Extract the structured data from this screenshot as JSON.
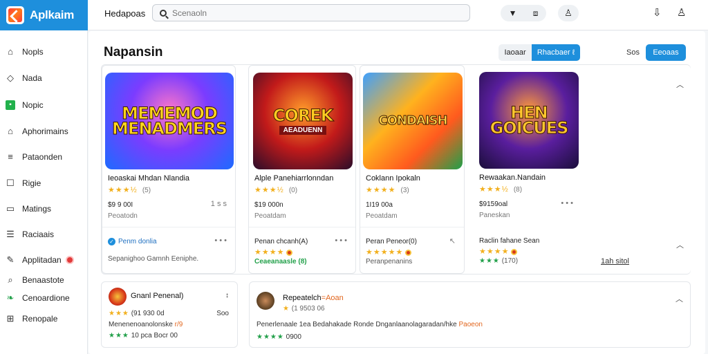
{
  "app": {
    "logo_text": "Aplkaim"
  },
  "topbar": {
    "title": "Hedapoas",
    "search_placeholder": "Scenaoln",
    "icons": [
      "filter-icon",
      "screen-icon",
      "user-icon",
      "download-icon",
      "account-icon"
    ],
    "filter_glyph": "▼",
    "screen_glyph": "⧈",
    "user_glyph": "♙",
    "download_glyph": "⇩",
    "account_glyph": "♙"
  },
  "sidebar": {
    "items": [
      {
        "label": "Nopls",
        "icon": "gamepad-icon",
        "glyph": "⌂"
      },
      {
        "label": "Nada",
        "icon": "tag-icon",
        "glyph": "◇"
      },
      {
        "label": "Nopic",
        "icon": "active-square-icon",
        "glyph": "▪"
      },
      {
        "label": "Aphorimains",
        "icon": "bag-icon",
        "glyph": "⌂"
      },
      {
        "label": "Pataonden",
        "icon": "list-icon",
        "glyph": "≡"
      },
      {
        "label": "Rigie",
        "icon": "box-icon",
        "glyph": "☐"
      },
      {
        "label": "Matings",
        "icon": "window-icon",
        "glyph": "▭"
      },
      {
        "label": "Raciaais",
        "icon": "stack-icon",
        "glyph": "☰"
      },
      {
        "label": "Applitadan",
        "icon": "pen-icon",
        "glyph": "✎"
      },
      {
        "label": "Benaastote",
        "icon": "search-icon",
        "glyph": "⌕"
      },
      {
        "label": "Cenoardione",
        "icon": "leaf-icon",
        "glyph": "❧"
      },
      {
        "label": "Renopale",
        "icon": "gift-icon",
        "glyph": "⊞"
      }
    ]
  },
  "main": {
    "title": "Napansin",
    "toggle": [
      "Iaoaar",
      "Rhacbaer ℓ"
    ],
    "sort_label": "Sos",
    "sort_button": "Eeoaas",
    "detail_link": "1ah sitol"
  },
  "cards": [
    {
      "art_title": "MEMEMOD MENADMERS",
      "art_sub": "",
      "title": "Ieoaskai Mhdan Nlandia",
      "stars": "★★★½",
      "rating": "(5)",
      "price": "$9 9 00I",
      "more": "1 s s",
      "sub": "Peoatodn",
      "review_title": "Penm donlia",
      "review_stars": "",
      "review_sub": "Sepanighoo Gamnh Eeniphe.",
      "review_more": "• • •"
    },
    {
      "art_title": "COREK",
      "art_sub": "AEADUENN",
      "title": "Alple Panehiarrlonndan",
      "stars": "★★★½",
      "rating": "(0)",
      "price": "$19 000n",
      "more": "",
      "sub": "Peoatdam",
      "review_title": "Penan chcanh(A)",
      "review_stars": "★★★★",
      "review_sub": "Ceaeanaasle  (8)",
      "review_more": "• • •"
    },
    {
      "art_title": "CONDAISH",
      "art_sub": "",
      "title": "Coklann Ipokaln",
      "stars": "★★★★",
      "rating": "(3)",
      "price": "1I19 00a",
      "more": "",
      "sub": "Peoatdam",
      "review_title": "Peran Peneor(0)",
      "review_stars": "★★★★★",
      "review_sub": "Peranpenanins",
      "review_more": "↖"
    },
    {
      "art_title": "HEN GOICUES",
      "art_sub": "",
      "title": "Rewaakan.Nandain",
      "stars": "★★★½",
      "rating": "(8)",
      "price": "$9159oal",
      "more": "• • •",
      "sub": "Paneskan",
      "review_title": "Raclin fahane Sean",
      "review_stars": "★★★★",
      "review_sub": "(170)",
      "review_more": ""
    }
  ],
  "bottom": [
    {
      "title": "Gnanl Penenal)",
      "more": "↕",
      "rating": "(91 930 0d",
      "link": "Soo",
      "line1": "Menenenoanolonske",
      "line1_accent": "r/9",
      "line2": "10 pca Bocr 00"
    },
    {
      "title": "Repeatelch",
      "title_accent": "=Aoan",
      "rating": "(1 9503 06",
      "line1": "Penerlenaale 1ea Bedahakade Ronde Dnganlaanolagaradan/hke",
      "line1_accent": "Paoeon",
      "line2": "0900"
    }
  ],
  "colors": {
    "accent": "#1e8fdc",
    "star": "#f2b01e",
    "green": "#22a04a",
    "alert": "#e23a3a"
  }
}
